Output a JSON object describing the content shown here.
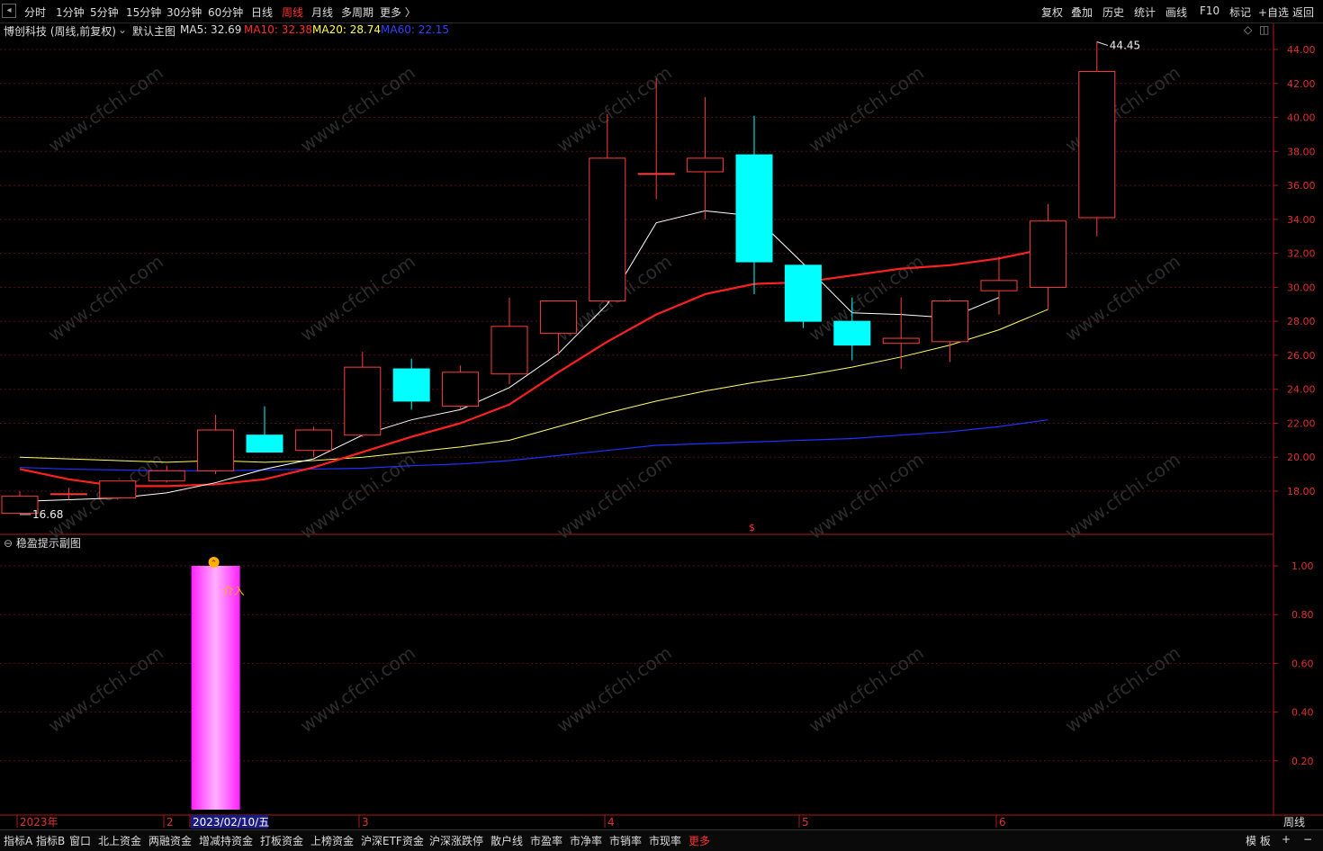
{
  "toolbar": {
    "periods": [
      "分时",
      "1分钟",
      "5分钟",
      "15分钟",
      "30分钟",
      "60分钟",
      "日线",
      "周线",
      "月线",
      "多周期",
      "更多 〉"
    ],
    "active_period": "周线",
    "right_buttons": [
      "复权",
      "叠加",
      "历史",
      "统计",
      "画线",
      "F10",
      "标记",
      "+自选",
      "返回"
    ]
  },
  "title": {
    "stock": "博创科技 (周线,前复权)",
    "template": "默认主图",
    "ma5": "MA5: 32.69",
    "ma10": "MA10: 32.38",
    "ma20": "MA20: 28.74",
    "ma60": "MA60: 22.15"
  },
  "colors": {
    "up": "#ff3c3c",
    "down": "#00ffff",
    "ma5": "#ffffff",
    "ma10": "#ff2020",
    "ma20": "#ffff60",
    "ma60": "#2030ff",
    "axis": "#b01818",
    "grid": "#5a1010",
    "signal_bar": "#ff40ff"
  },
  "chart_data": {
    "type": "candlestick",
    "period": "weekly",
    "ylim": [
      16,
      45
    ],
    "y_ticks": [
      "44.00",
      "42.00",
      "40.00",
      "38.00",
      "36.00",
      "34.00",
      "32.00",
      "30.00",
      "28.00",
      "26.00",
      "24.00",
      "22.00",
      "20.00",
      "18.00"
    ],
    "candles": [
      {
        "o": 16.7,
        "h": 18.0,
        "l": 16.68,
        "c": 17.7
      },
      {
        "o": 17.8,
        "h": 18.2,
        "l": 17.5,
        "c": 17.85
      },
      {
        "o": 17.6,
        "h": 18.6,
        "l": 17.5,
        "c": 18.6
      },
      {
        "o": 18.6,
        "h": 19.5,
        "l": 18.5,
        "c": 19.2
      },
      {
        "o": 19.2,
        "h": 22.5,
        "l": 19.0,
        "c": 21.6
      },
      {
        "o": 21.3,
        "h": 23.0,
        "l": 20.3,
        "c": 20.3
      },
      {
        "o": 20.4,
        "h": 21.8,
        "l": 20.0,
        "c": 21.6
      },
      {
        "o": 21.3,
        "h": 26.2,
        "l": 21.2,
        "c": 25.3
      },
      {
        "o": 25.2,
        "h": 25.8,
        "l": 22.8,
        "c": 23.3
      },
      {
        "o": 23.0,
        "h": 25.4,
        "l": 22.8,
        "c": 25.0
      },
      {
        "o": 24.9,
        "h": 29.4,
        "l": 24.3,
        "c": 27.7
      },
      {
        "o": 27.3,
        "h": 28.0,
        "l": 26.0,
        "c": 29.2
      },
      {
        "o": 29.2,
        "h": 40.2,
        "l": 29.1,
        "c": 37.6
      },
      {
        "o": 36.7,
        "h": 42.3,
        "l": 35.2,
        "c": 36.7
      },
      {
        "o": 36.8,
        "h": 41.2,
        "l": 34.0,
        "c": 37.6
      },
      {
        "o": 37.8,
        "h": 40.1,
        "l": 29.6,
        "c": 31.5
      },
      {
        "o": 31.3,
        "h": 31.4,
        "l": 27.6,
        "c": 28.0
      },
      {
        "o": 28.0,
        "h": 29.4,
        "l": 25.7,
        "c": 26.6
      },
      {
        "o": 26.7,
        "h": 29.4,
        "l": 25.2,
        "c": 27.0
      },
      {
        "o": 26.8,
        "h": 29.3,
        "l": 25.6,
        "c": 29.2
      },
      {
        "o": 29.8,
        "h": 31.8,
        "l": 28.4,
        "c": 30.4
      },
      {
        "o": 30.0,
        "h": 34.9,
        "l": 28.7,
        "c": 33.9
      },
      {
        "o": 34.1,
        "h": 44.45,
        "l": 33.0,
        "c": 42.7
      }
    ],
    "ma5": [
      17.4,
      17.5,
      17.6,
      17.9,
      18.5,
      19.3,
      19.9,
      21.3,
      22.2,
      22.8,
      24.1,
      26.1,
      29.0,
      33.8,
      34.5,
      34.2,
      31.4,
      28.5,
      28.4,
      28.2,
      29.4
    ],
    "ma10": [
      19.3,
      18.7,
      18.3,
      18.3,
      18.4,
      18.7,
      19.4,
      20.3,
      21.2,
      22.0,
      23.1,
      25.0,
      26.8,
      28.4,
      29.6,
      30.2,
      30.3,
      30.7,
      31.1,
      31.3,
      31.7,
      32.3
    ],
    "ma20": [
      20.0,
      19.9,
      19.8,
      19.7,
      19.8,
      19.7,
      19.8,
      20.0,
      20.3,
      20.6,
      21.0,
      21.8,
      22.6,
      23.3,
      23.9,
      24.4,
      24.8,
      25.3,
      25.9,
      26.6,
      27.5,
      28.7
    ],
    "ma60": [
      19.4,
      19.3,
      19.25,
      19.2,
      19.2,
      19.25,
      19.3,
      19.35,
      19.5,
      19.6,
      19.8,
      20.1,
      20.4,
      20.7,
      20.8,
      20.9,
      21.0,
      21.1,
      21.3,
      21.5,
      21.8,
      22.2
    ],
    "low_label": "16.68",
    "high_label": "44.45",
    "x_labels": [
      "2023年",
      "2",
      "2023/02/10/五",
      "3",
      "4",
      "5",
      "6"
    ],
    "sub_title": "稳盈提示副图",
    "sub_ylim": [
      0,
      1.05
    ],
    "sub_y_ticks": [
      "1.00",
      "0.80",
      "0.60",
      "0.40",
      "0.20"
    ],
    "sub_signal": {
      "index": 4,
      "value": 1.0,
      "marker": "介入"
    },
    "corner_label": "周线"
  },
  "watermark": "www.cfchi.com",
  "bottom_tabs": [
    "指标A",
    "指标B",
    "窗口",
    "北上资金",
    "两融资金",
    "增减持资金",
    "打板资金",
    "上榜资金",
    "沪深ETF资金",
    "沪深涨跌停",
    "散户线",
    "市盈率",
    "市净率",
    "市销率",
    "市现率",
    "更多"
  ],
  "bottom_right": [
    "模 板",
    "+",
    "−"
  ]
}
